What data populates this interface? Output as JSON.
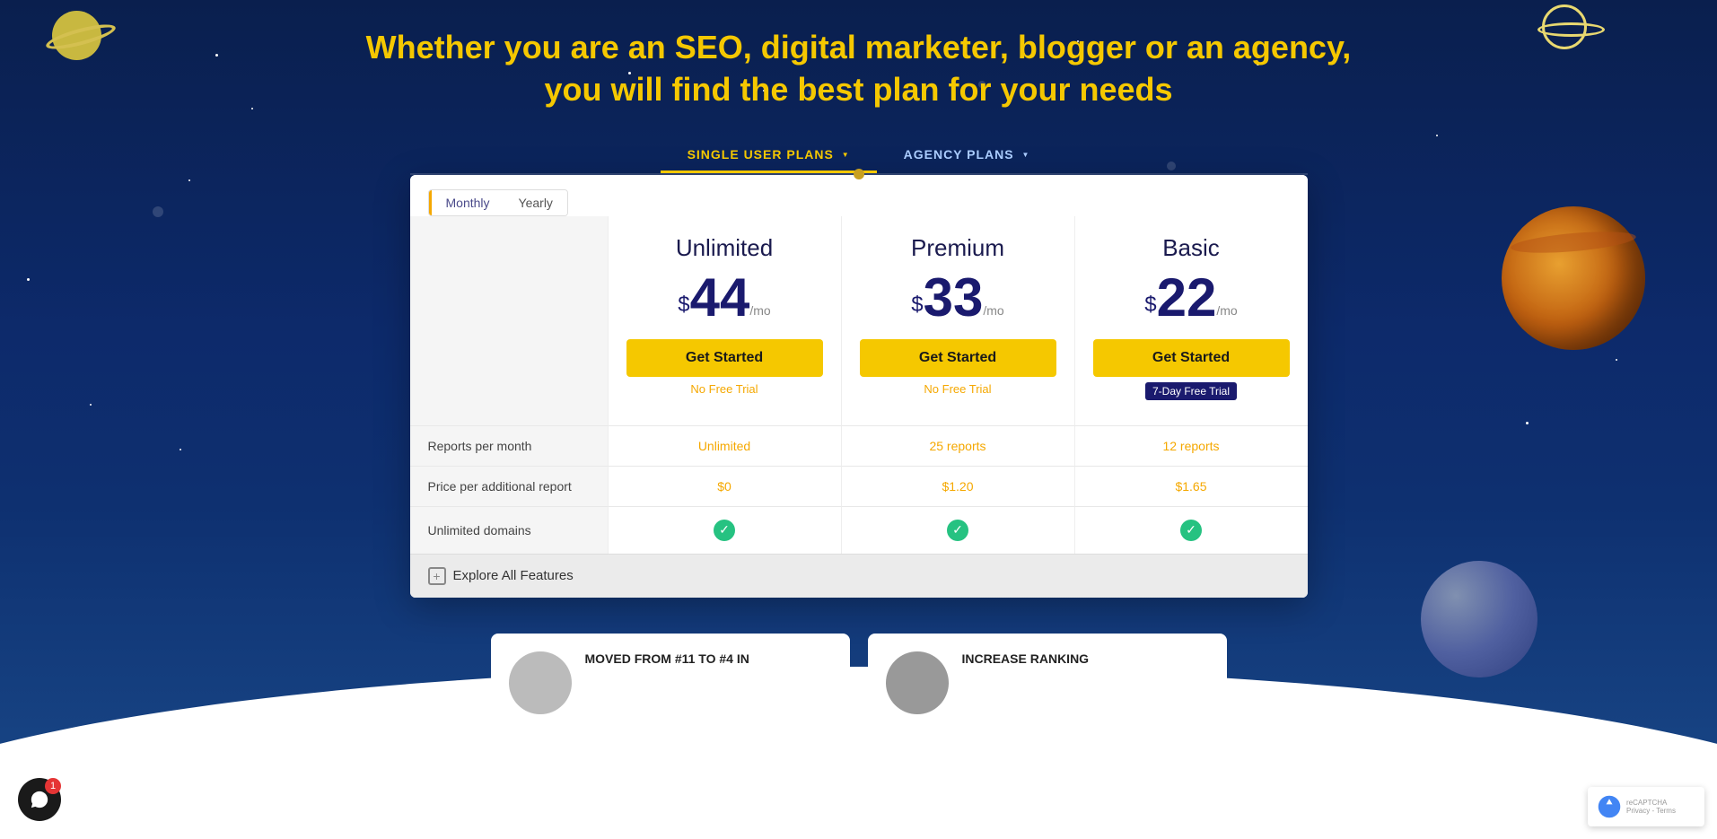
{
  "page": {
    "hero_title_line1": "Whether you are an SEO, digital marketer, blogger or an agency,",
    "hero_title_line2": "you will find the best plan for your needs"
  },
  "tabs": {
    "single_user": "SINGLE USER PLANS",
    "agency": "AGENCY PLANS"
  },
  "billing": {
    "monthly": "Monthly",
    "yearly": "Yearly"
  },
  "plans": [
    {
      "id": "unlimited",
      "name": "Unlimited",
      "price_symbol": "$",
      "price": "44",
      "per": "/mo",
      "btn_label": "Get Started",
      "trial_text": "No Free Trial",
      "reports": "Unlimited",
      "price_additional": "$0",
      "unlimited_domains": true
    },
    {
      "id": "premium",
      "name": "Premium",
      "price_symbol": "$",
      "price": "33",
      "per": "/mo",
      "btn_label": "Get Started",
      "trial_text": "No Free Trial",
      "reports": "25 reports",
      "price_additional": "$1.20",
      "unlimited_domains": true
    },
    {
      "id": "basic",
      "name": "Basic",
      "price_symbol": "$",
      "price": "22",
      "per": "/mo",
      "btn_label": "Get Started",
      "trial_badge": "7-Day Free Trial",
      "reports": "12 reports",
      "price_additional": "$1.65",
      "unlimited_domains": true
    }
  ],
  "features": {
    "reports_label": "Reports per month",
    "price_additional_label": "Price per additional report",
    "unlimited_domains_label": "Unlimited domains"
  },
  "explore": {
    "label": "Explore All Features"
  },
  "testimonials": [
    {
      "title": "MOVED FROM #11 TO #4 IN",
      "avatar_color": "#bbb"
    },
    {
      "title": "INCREASE RANKING",
      "avatar_color": "#999"
    }
  ],
  "chat": {
    "badge": "1"
  },
  "recaptcha": {
    "line1": "Privacy - Terms"
  }
}
